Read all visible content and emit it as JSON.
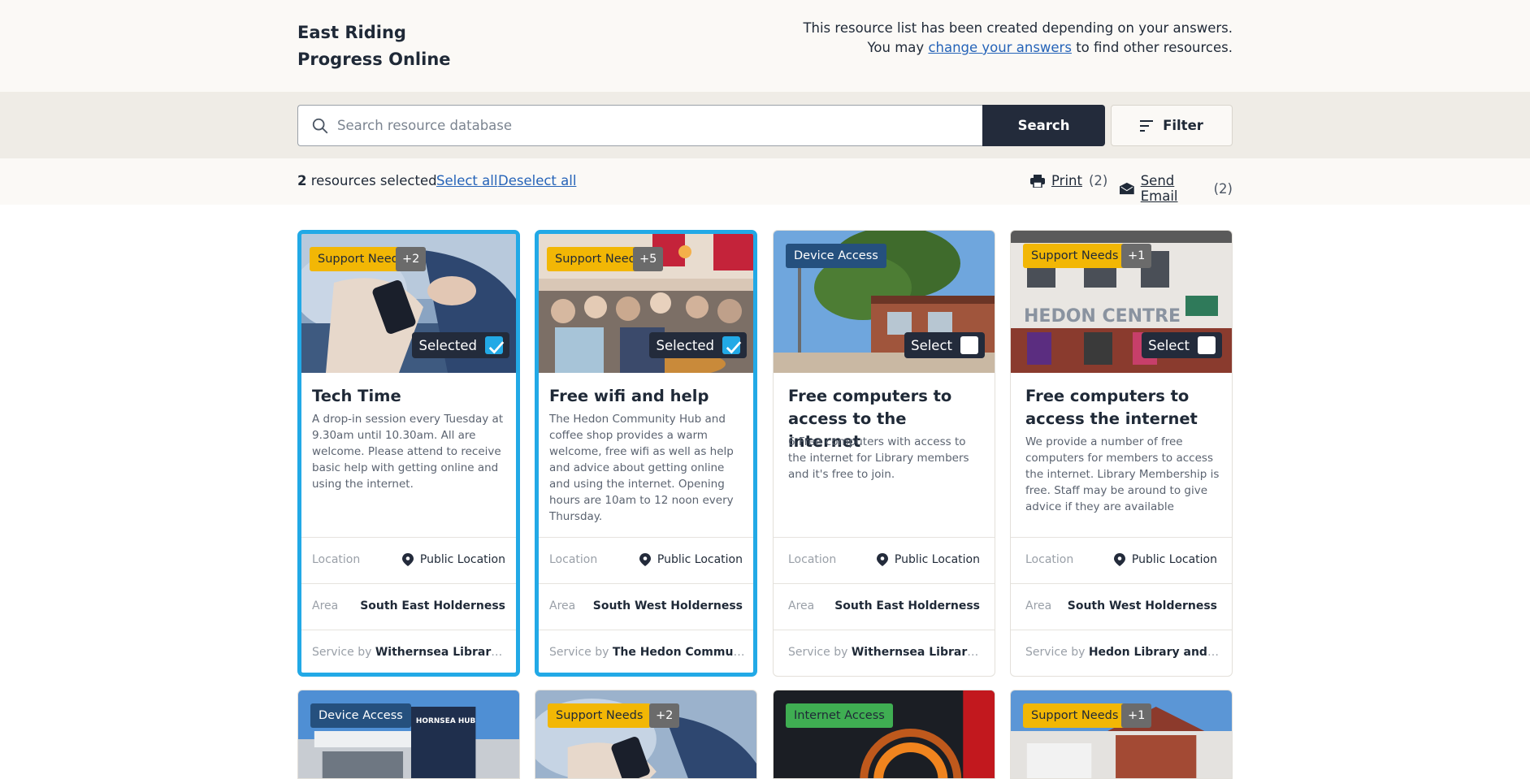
{
  "header": {
    "brand_line1": "East Riding",
    "brand_line2": "Progress Online",
    "intro_line1": "This resource list has been created depending on your answers.",
    "intro_pre": "You may ",
    "intro_link": "change your answers",
    "intro_post": " to find other resources."
  },
  "search": {
    "placeholder": "Search resource database",
    "button_label": "Search",
    "filter_label": "Filter"
  },
  "selection": {
    "count": "2",
    "count_suffix": " resources selected",
    "select_all": "Select all",
    "deselect_all": "Deselect all",
    "print_label": "Print",
    "print_count": "(2)",
    "email_label": "Send Email",
    "email_count": "(2)"
  },
  "labels": {
    "location": "Location",
    "area": "Area",
    "service_by": "Service by"
  },
  "cards": [
    {
      "tag": "Support Needs",
      "tag_more": "+2",
      "select_label": "Selected",
      "selected": true,
      "title": "Tech Time",
      "description": "A drop-in session every Tuesday at 9.30am until 10.30am. All are welcome. Please attend to receive basic help with getting online and using the internet.",
      "location": "Public Location",
      "area": "South East Holderness",
      "service": "Withernsea Library an..."
    },
    {
      "tag": "Support Needs",
      "tag_more": "+5",
      "select_label": "Selected",
      "selected": true,
      "title": "Free wifi and help",
      "description": "The Hedon Community Hub and coffee shop provides a warm welcome, free wifi as well as help and advice about getting online and using the internet. Opening hours are 10am to 12 noon every Thursday.",
      "location": "Public Location",
      "area": "South West Holderness",
      "service": "The Hedon Communit..."
    },
    {
      "tag": "Device Access",
      "tag_more": "",
      "select_label": "Select",
      "selected": false,
      "title": "Free computers to access to the internet",
      "description": "6 Free computers with access to the internet for Library members and it's free to join.",
      "location": "Public Location",
      "area": "South East Holderness",
      "service": "Withernsea Library an..."
    },
    {
      "tag": "Support Needs",
      "tag_more": "+1",
      "select_label": "Select",
      "selected": false,
      "title": "Free computers to access the internet",
      "description": "We provide a number of free computers for members to access the internet. Library Membership is free. Staff may be around to give advice if they are available",
      "location": "Public Location",
      "area": "South West Holderness",
      "service": "Hedon Library and Cu..."
    }
  ],
  "cards_row2": [
    {
      "tag": "Device Access",
      "tag_more": ""
    },
    {
      "tag": "Support Needs",
      "tag_more": "+2"
    },
    {
      "tag": "Internet Access",
      "tag_more": ""
    },
    {
      "tag": "Support Needs",
      "tag_more": "+1"
    }
  ],
  "image_text": {
    "hedon_centre_sign": "HEDON CENTRE",
    "hornsea_hub_sign": "HORNSEA HUB"
  },
  "colors": {
    "selected_border": "#22a9e6",
    "primary_dark": "#232b3b",
    "support_tag": "#f2b705",
    "device_tag": "#25507e",
    "internet_tag": "#3fae52",
    "link": "#2563b8"
  }
}
